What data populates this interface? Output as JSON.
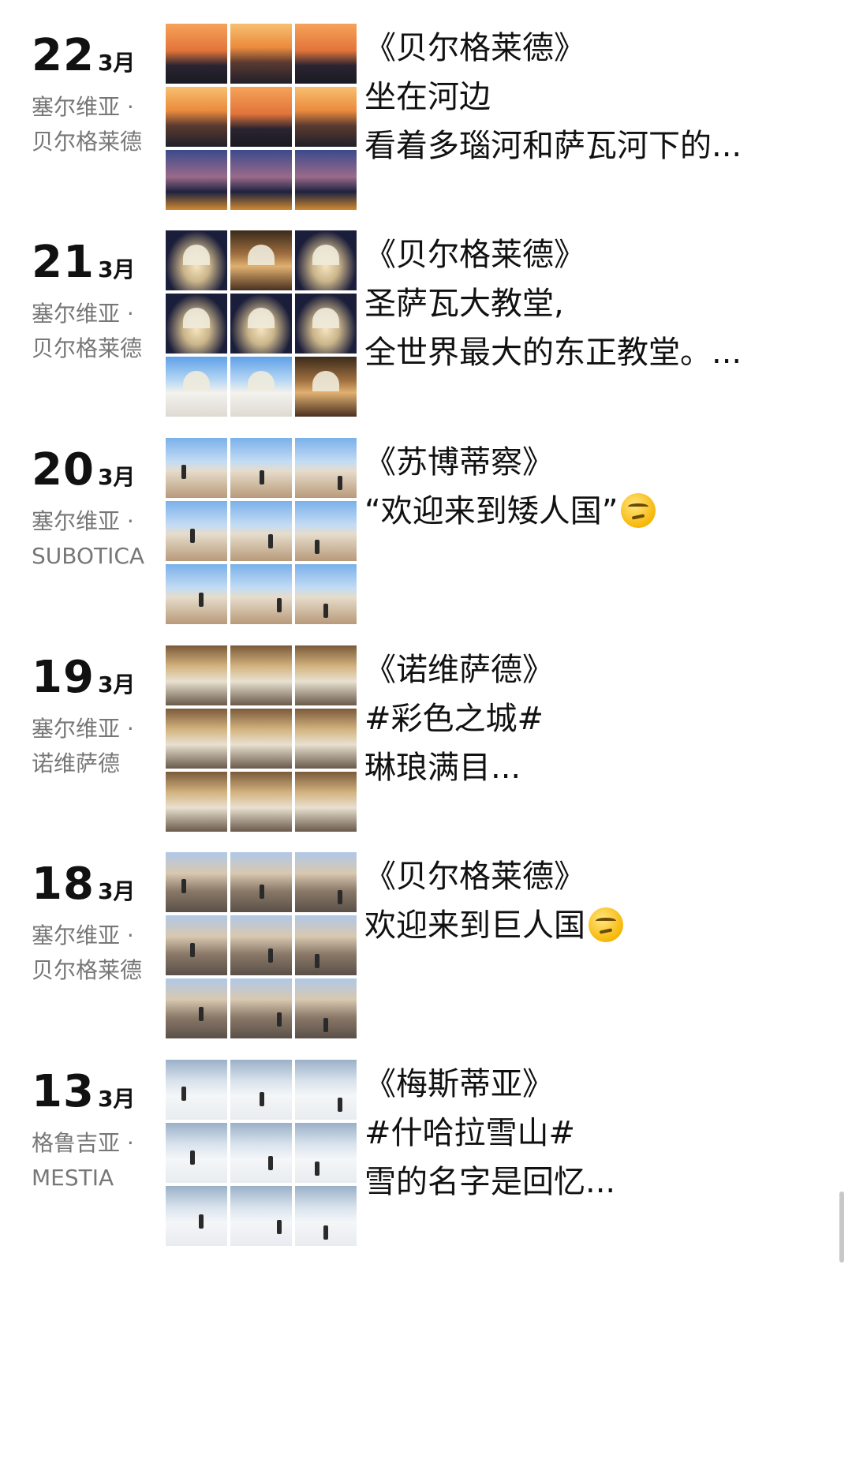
{
  "posts": [
    {
      "day": "22",
      "month": "3月",
      "location": [
        "塞尔维亚 ·",
        "贝尔格莱德"
      ],
      "lines": [
        "《贝尔格莱德》",
        "坐在河边",
        "看着多瑙河和萨瓦河下的..."
      ],
      "emoji": false
    },
    {
      "day": "21",
      "month": "3月",
      "location": [
        "塞尔维亚 ·",
        "贝尔格莱德"
      ],
      "lines": [
        "《贝尔格莱德》",
        "圣萨瓦大教堂,",
        "全世界最大的东正教堂。..."
      ],
      "emoji": false
    },
    {
      "day": "20",
      "month": "3月",
      "location": [
        "塞尔维亚 ·",
        "SUBOTICA"
      ],
      "lines": [
        "《苏博蒂察》",
        "“欢迎来到矮人国”"
      ],
      "emoji": true
    },
    {
      "day": "19",
      "month": "3月",
      "location": [
        "塞尔维亚 ·",
        "诺维萨德"
      ],
      "lines": [
        "《诺维萨德》",
        "#彩色之城#",
        "  琳琅满目..."
      ],
      "emoji": false
    },
    {
      "day": "18",
      "month": "3月",
      "location": [
        "塞尔维亚 ·",
        "贝尔格莱德"
      ],
      "lines": [
        "《贝尔格莱德》",
        "欢迎来到巨人国"
      ],
      "emoji": true
    },
    {
      "day": "13",
      "month": "3月",
      "location": [
        "格鲁吉亚 ·",
        "MESTIA"
      ],
      "lines": [
        "《梅斯蒂亚》",
        "#什哈拉雪山#",
        "雪的名字是回忆..."
      ],
      "emoji": false
    }
  ],
  "thumb_themes": [
    [
      "sunset",
      "sunset2",
      "sunset",
      "sunset2",
      "sunset",
      "sunset2",
      "dusk",
      "dusk",
      "dusk"
    ],
    [
      "church-night",
      "church-int",
      "church-night",
      "church-night",
      "church-night",
      "church-night",
      "church-day",
      "church-day",
      "church-int"
    ],
    [
      "square",
      "square",
      "square",
      "square",
      "square",
      "square",
      "square",
      "square",
      "square"
    ],
    [
      "shop",
      "shop",
      "shop",
      "shop",
      "shop",
      "shop",
      "shop",
      "shop",
      "shop"
    ],
    [
      "street",
      "street",
      "street",
      "street",
      "street",
      "street",
      "street",
      "street",
      "street"
    ],
    [
      "snow",
      "snow",
      "snow",
      "snow",
      "snow",
      "snow",
      "snow",
      "snow",
      "snow"
    ]
  ],
  "emoji_icon": "thinking-face-icon"
}
